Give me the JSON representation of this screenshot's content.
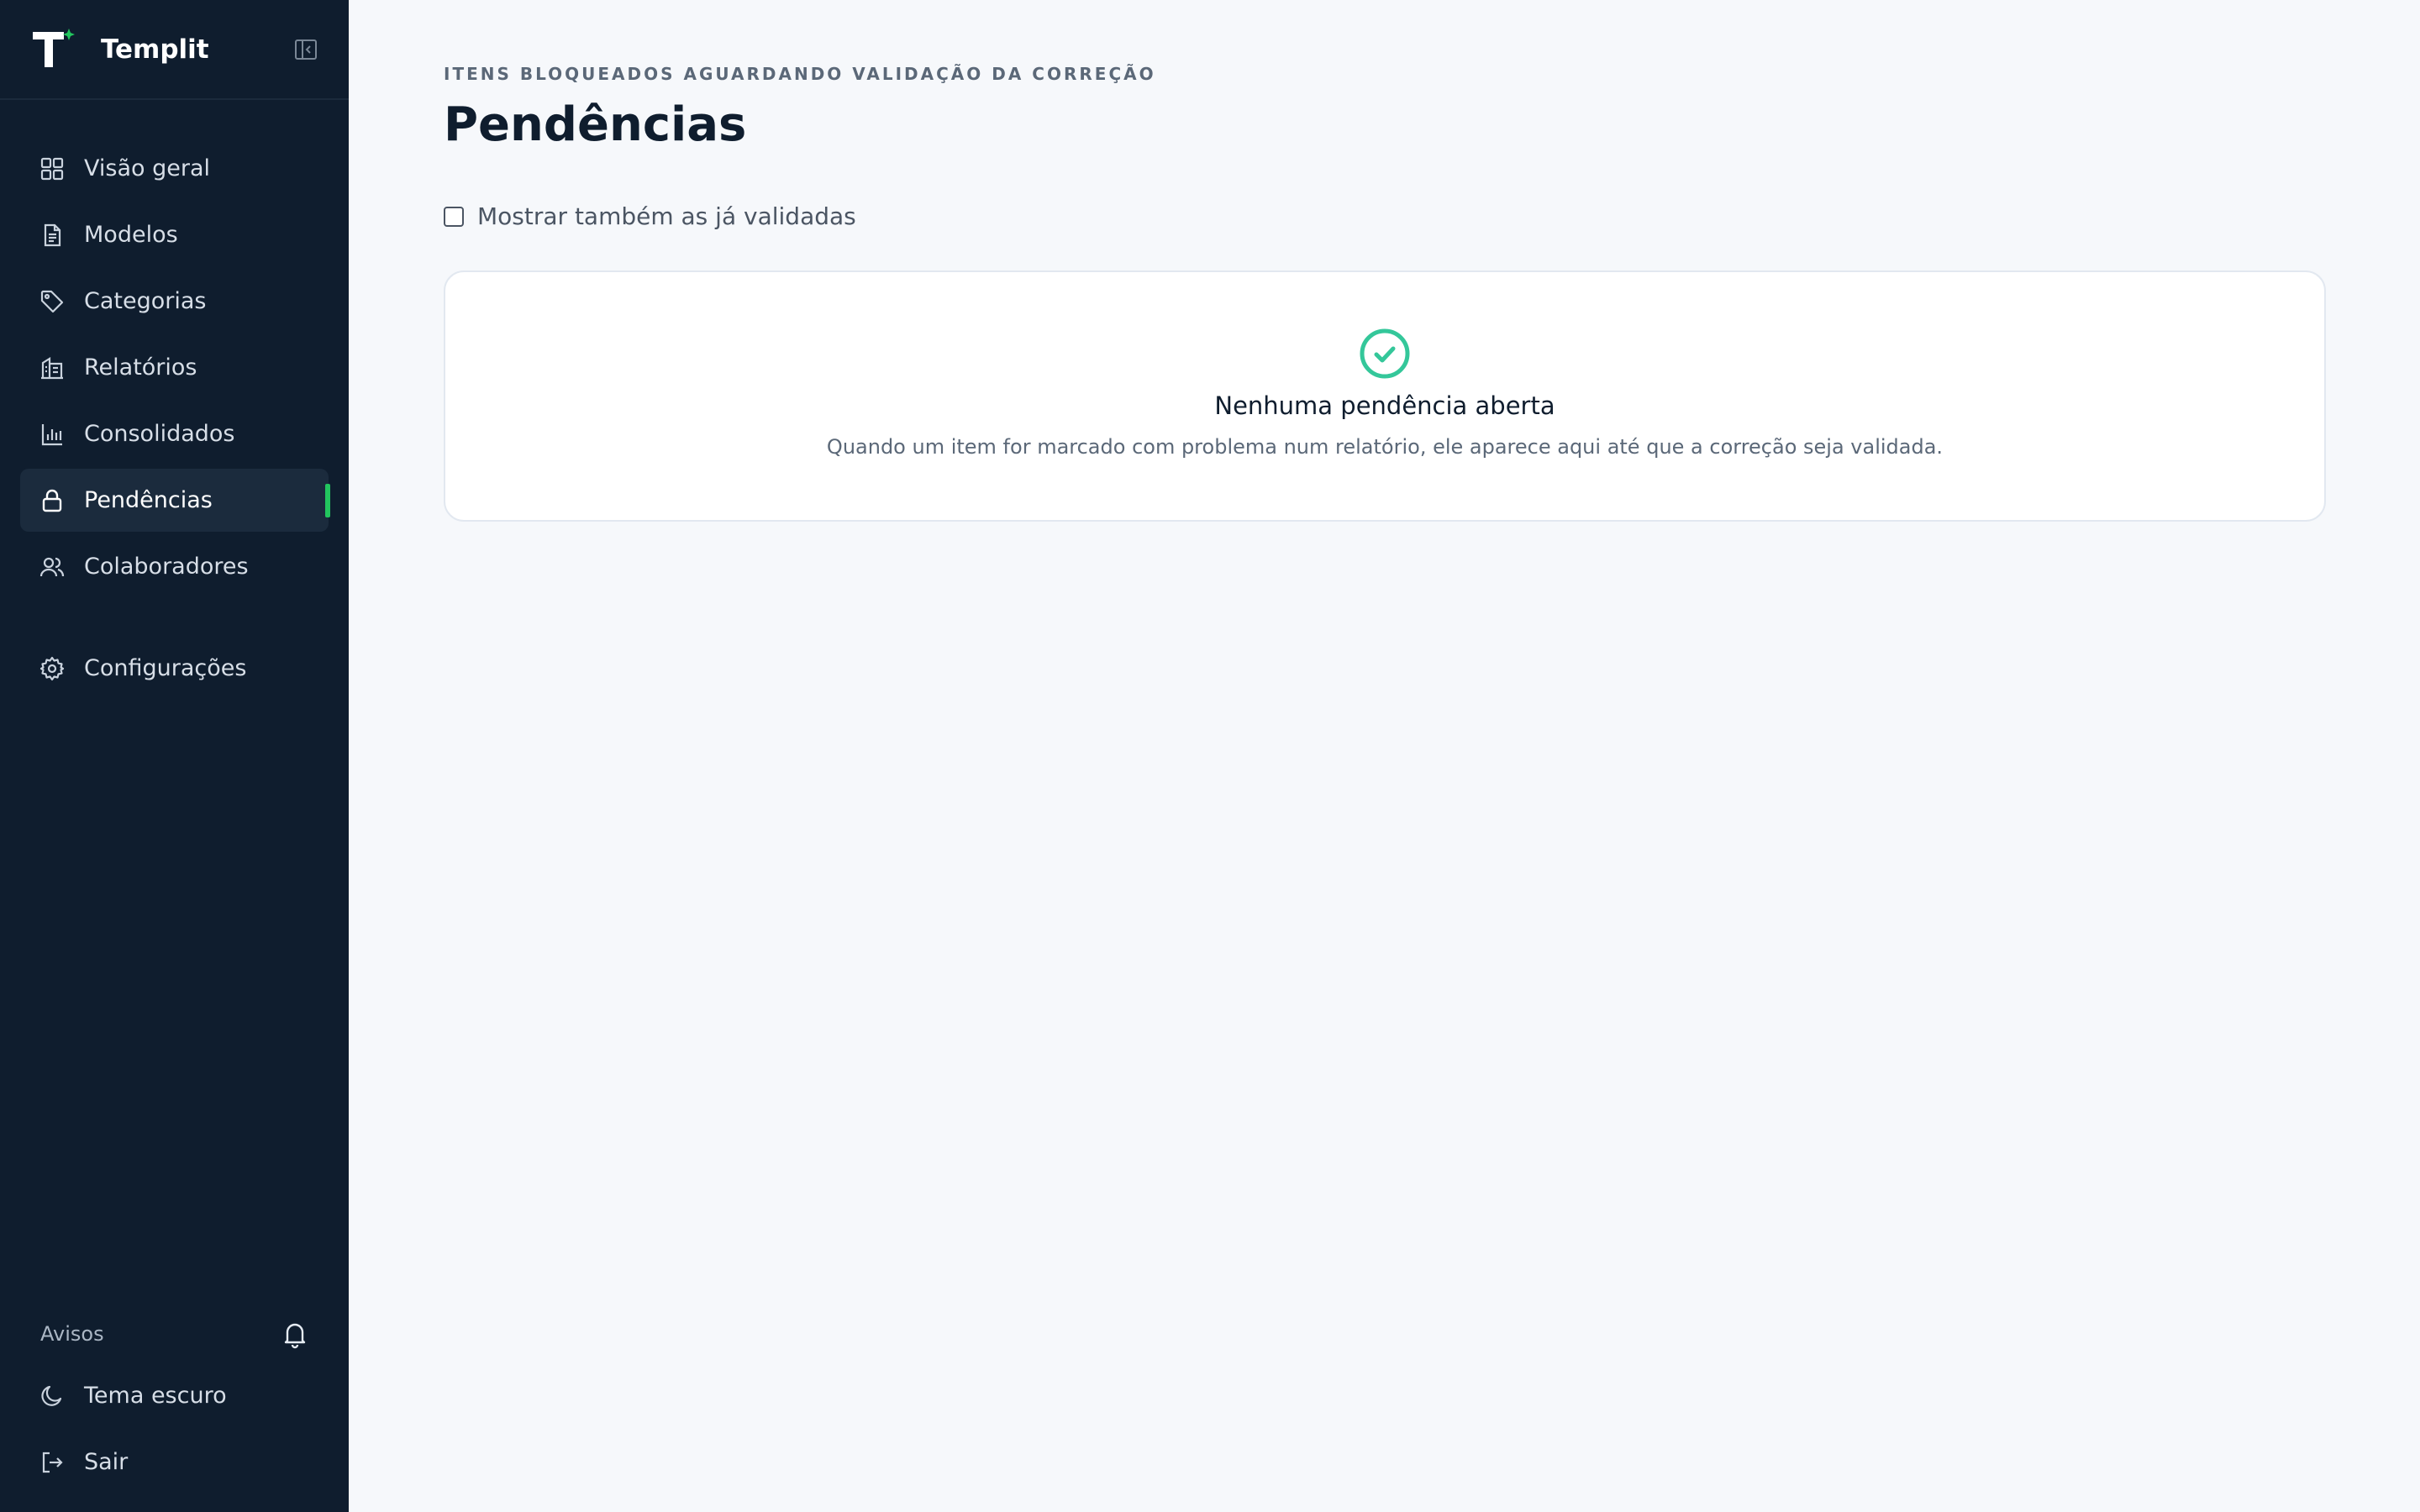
{
  "brand": {
    "name": "Templit",
    "logo_letter": "T",
    "accent": "#22c55e"
  },
  "sidebar": {
    "items": [
      {
        "label": "Visão geral",
        "icon": "grid-icon"
      },
      {
        "label": "Modelos",
        "icon": "document-icon"
      },
      {
        "label": "Categorias",
        "icon": "tag-icon"
      },
      {
        "label": "Relatórios",
        "icon": "building-icon"
      },
      {
        "label": "Consolidados",
        "icon": "bar-chart-icon"
      },
      {
        "label": "Pendências",
        "icon": "lock-icon",
        "active": true
      },
      {
        "label": "Colaboradores",
        "icon": "users-icon"
      }
    ],
    "settings": {
      "label": "Configurações",
      "icon": "gear-icon"
    },
    "avisos": {
      "label": "Avisos",
      "icon": "bell-icon"
    },
    "theme": {
      "label": "Tema escuro",
      "icon": "moon-icon"
    },
    "logout": {
      "label": "Sair",
      "icon": "logout-icon"
    }
  },
  "main": {
    "eyebrow": "ITENS BLOQUEADOS AGUARDANDO VALIDAÇÃO DA CORREÇÃO",
    "title": "Pendências",
    "filter": {
      "label": "Mostrar também as já validadas",
      "checked": false
    },
    "empty": {
      "title": "Nenhuma pendência aberta",
      "text": "Quando um item for marcado com problema num relatório, ele aparece aqui até que a correção seja validada."
    }
  },
  "colors": {
    "sidebar_bg": "#0f1d2e",
    "active_indicator": "#22c55e",
    "success_icon": "#34c79a",
    "page_bg": "#f6f8fb"
  }
}
